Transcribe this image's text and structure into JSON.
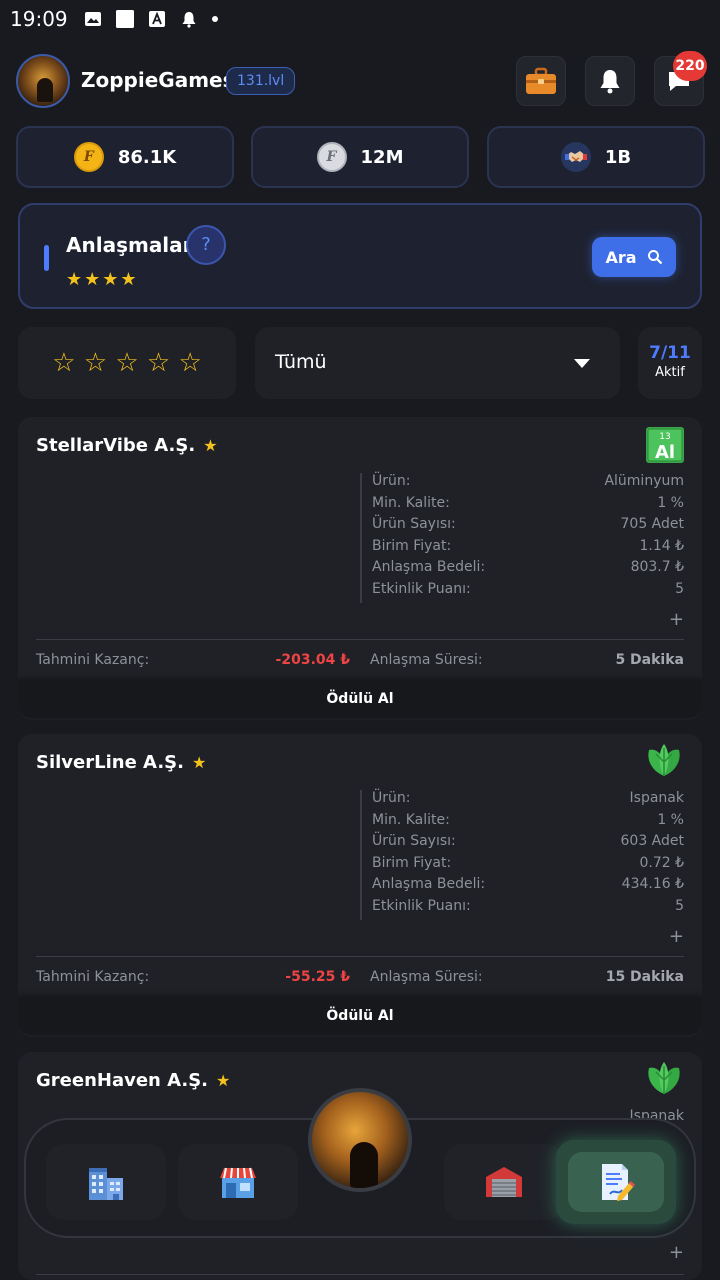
{
  "status_bar": {
    "time": "19:09"
  },
  "header": {
    "username": "ZoppieGames",
    "level": "131.lvl",
    "messages_badge": "220"
  },
  "currencies": [
    {
      "value": "86.1K",
      "icon": "gold-coin-icon"
    },
    {
      "value": "12M",
      "icon": "silver-coin-icon"
    },
    {
      "value": "1B",
      "icon": "handshake-icon"
    }
  ],
  "deals_panel": {
    "title": "Anlaşmalar",
    "rating_stars": "★★★★",
    "search_button": "Ara"
  },
  "filters": {
    "star_filter": "☆ ☆ ☆ ☆ ☆",
    "category_selected": "Tümü",
    "active_count": "7/11",
    "active_label": "Aktif"
  },
  "labels": {
    "product": "Ürün:",
    "min_quality": "Min. Kalite:",
    "product_count": "Ürün Sayısı:",
    "unit_price": "Birim Fiyat:",
    "deal_value": "Anlaşma Bedeli:",
    "activity_points": "Etkinlik Puanı:",
    "estimated_profit": "Tahmini Kazanç:",
    "deal_duration": "Anlaşma Süresi:",
    "claim_button": "Ödülü Al",
    "expand": "+"
  },
  "deals": [
    {
      "company": "StellarVibe A.Ş.",
      "star": "★",
      "product_icon": "aluminium-element-icon",
      "product_icon_number": "13",
      "product_icon_symbol": "Al",
      "product": "Alüminyum",
      "min_quality": "1 %",
      "product_count": "705 Adet",
      "unit_price": "1.14 ₺",
      "deal_value": "803.7 ₺",
      "activity_points": "5",
      "estimated_profit": "-203.04 ₺",
      "deal_duration": "5 Dakika"
    },
    {
      "company": "SilverLine A.Ş.",
      "star": "★",
      "product_icon": "spinach-leaf-icon",
      "product": "Ispanak",
      "min_quality": "1 %",
      "product_count": "603 Adet",
      "unit_price": "0.72 ₺",
      "deal_value": "434.16 ₺",
      "activity_points": "5",
      "estimated_profit": "-55.25 ₺",
      "deal_duration": "15 Dakika"
    },
    {
      "company": "GreenHaven A.Ş.",
      "star": "★",
      "product_icon": "spinach-leaf-icon",
      "product": "Ispanak"
    }
  ],
  "bottom_nav": [
    {
      "name": "company-building-icon"
    },
    {
      "name": "shop-icon"
    },
    {
      "name": "profile-avatar"
    },
    {
      "name": "warehouse-icon"
    },
    {
      "name": "contracts-icon",
      "selected": true
    }
  ]
}
